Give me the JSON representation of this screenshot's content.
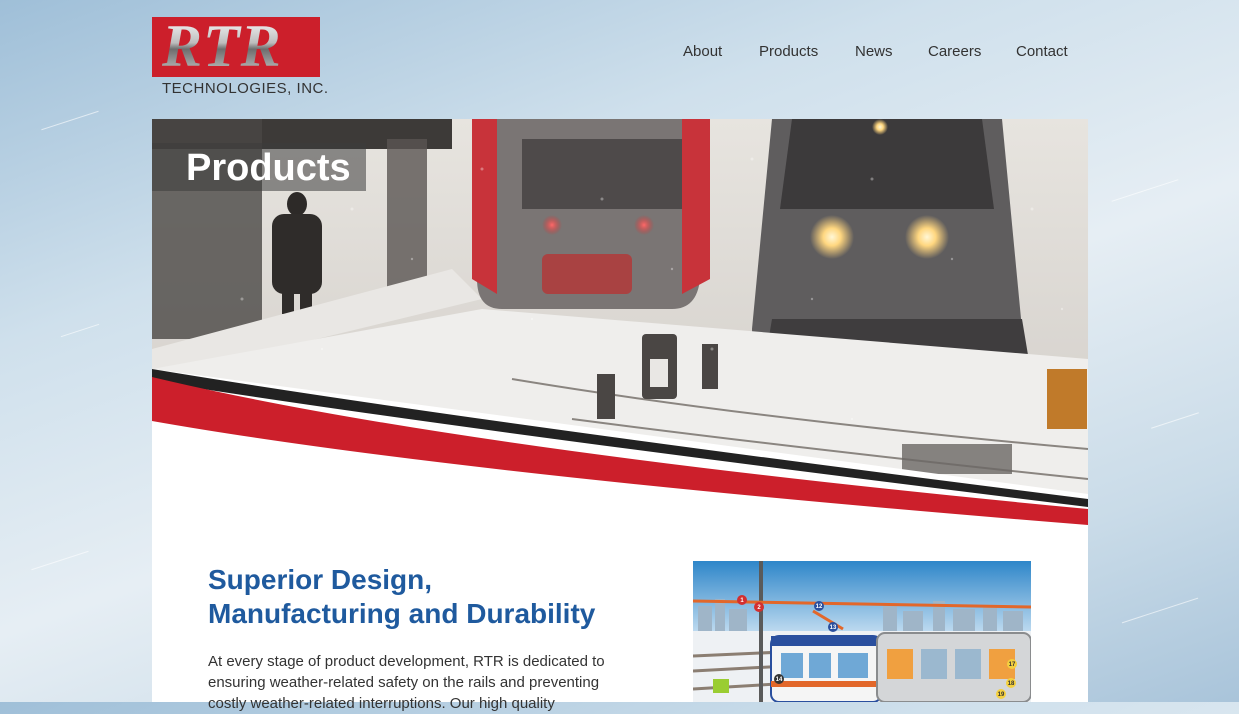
{
  "brand": {
    "logo_text": "RTR",
    "logo_subtext": "TECHNOLOGIES, INC.",
    "accent_red": "#cc1f2b",
    "heading_blue": "#1f5a9e"
  },
  "nav": {
    "items": [
      {
        "label": "About"
      },
      {
        "label": "Products"
      },
      {
        "label": "News"
      },
      {
        "label": "Careers"
      },
      {
        "label": "Contact"
      }
    ]
  },
  "hero": {
    "title": "Products",
    "image": "trains-in-snowstorm"
  },
  "main": {
    "heading_line1": "Superior Design,",
    "heading_line2": "Manufacturing and Durability",
    "intro": "At every stage of product development, RTR is dedicated to ensuring weather-related safety on the rails and preventing costly weather-related interruptions. Our high quality",
    "illustration": {
      "image": "rail-system-diagram",
      "markers": [
        "1",
        "2",
        "12",
        "13",
        "14",
        "17",
        "18",
        "19"
      ]
    }
  }
}
